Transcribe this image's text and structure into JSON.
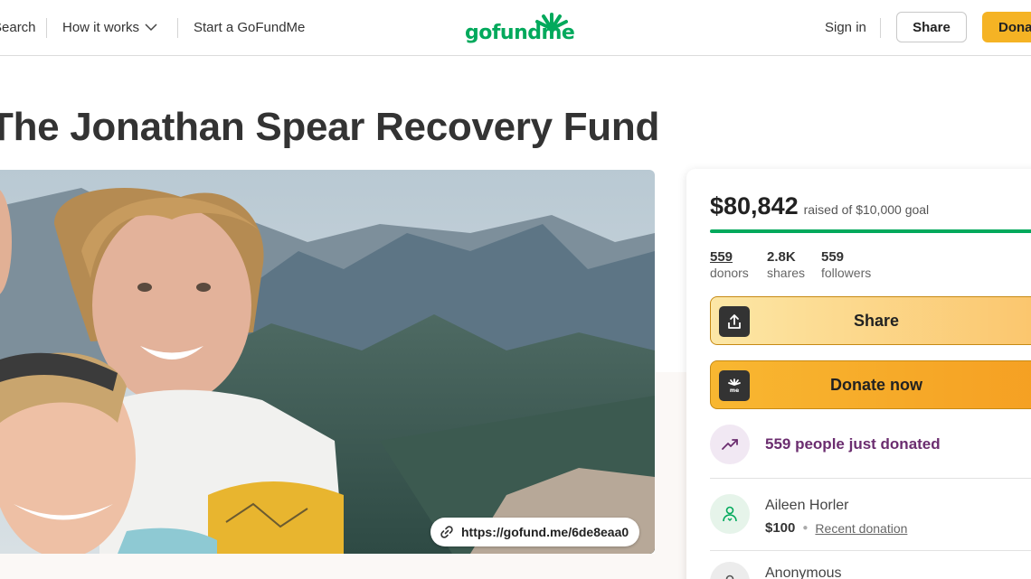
{
  "header": {
    "search_label": "Search",
    "how_it_works_label": "How it works",
    "start_label": "Start a GoFundMe",
    "logo_text": "gofundme",
    "sign_in_label": "Sign in",
    "share_label": "Share",
    "donate_label": "Donate"
  },
  "campaign": {
    "title": "The Jonathan Spear Recovery Fund",
    "short_link": "https://gofund.me/6de8eaa0"
  },
  "sidebar": {
    "raised_amount": "$80,842",
    "raised_goal_text": "raised of $10,000 goal",
    "progress_fraction": 1.0,
    "stats": [
      {
        "value": "559",
        "label": "donors"
      },
      {
        "value": "2.8K",
        "label": "shares"
      },
      {
        "value": "559",
        "label": "followers"
      }
    ],
    "share_button_label": "Share",
    "donate_button_label": "Donate now",
    "trend_text": "559 people just donated",
    "recent_donation": {
      "name": "Aileen Horler",
      "amount": "$100",
      "tag": "Recent donation"
    },
    "next_donor_name": "Anonymous"
  },
  "colors": {
    "brand_green": "#02a95c",
    "donate_orange": "#f5b324",
    "trend_purple": "#6b2d6f"
  },
  "icons": {
    "chevron": "chevron-down-icon",
    "link": "link-icon",
    "share": "share-upload-icon",
    "donate": "gofundme-logo-icon",
    "trend": "trending-up-icon",
    "donor": "donor-heart-icon",
    "anon": "person-icon"
  }
}
